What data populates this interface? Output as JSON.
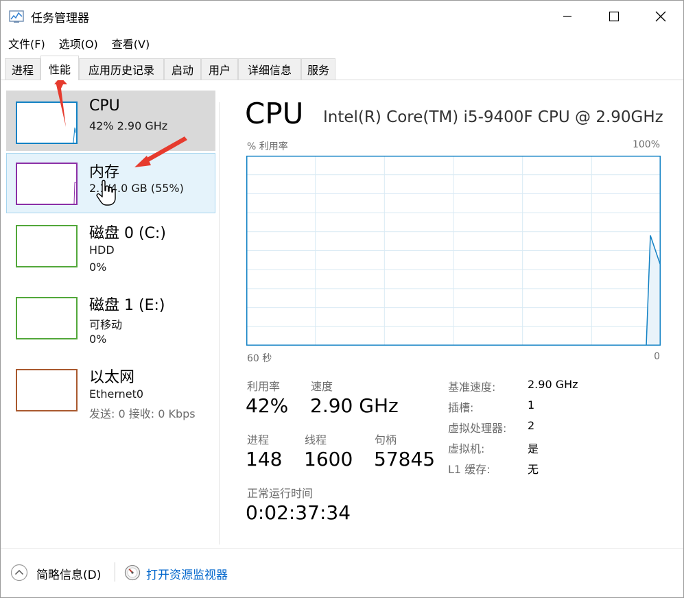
{
  "window": {
    "title": "任务管理器",
    "controls": [
      "minimize",
      "maximize",
      "close"
    ]
  },
  "menu": [
    "文件(F)",
    "选项(O)",
    "查看(V)"
  ],
  "tabs": [
    {
      "label": "进程"
    },
    {
      "label": "性能"
    },
    {
      "label": "应用历史记录"
    },
    {
      "label": "启动"
    },
    {
      "label": "用户"
    },
    {
      "label": "详细信息"
    },
    {
      "label": "服务"
    }
  ],
  "active_tab": "性能",
  "sidebar": [
    {
      "title": "CPU",
      "line1": "42% 2.90 GHz",
      "line2": "",
      "color": "#1181c4",
      "state": "selected"
    },
    {
      "title": "内存",
      "line1": "2.1/4.0 GB (55%)",
      "line2": "",
      "color": "#8b2fa6",
      "state": "hover"
    },
    {
      "title": "磁盘 0 (C:)",
      "line1": "HDD",
      "line2": "0%",
      "color": "#52a73a",
      "state": ""
    },
    {
      "title": "磁盘 1 (E:)",
      "line1": "可移动",
      "line2": "0%",
      "color": "#52a73a",
      "state": ""
    },
    {
      "title": "以太网",
      "line1": "Ethernet0",
      "line2": "发送: 0 接收: 0 Kbps",
      "color": "#a9592e",
      "state": ""
    }
  ],
  "main": {
    "heading": "CPU",
    "model": "Intel(R) Core(TM) i5-9400F CPU @ 2.90GHz",
    "graph_label": "% 利用率",
    "graph_max": "100%",
    "time_left": "60 秒",
    "time_right": "0",
    "stats": {
      "utilization_label": "利用率",
      "utilization": "42%",
      "speed_label": "速度",
      "speed": "2.90 GHz",
      "processes_label": "进程",
      "processes": "148",
      "threads_label": "线程",
      "threads": "1600",
      "handles_label": "句柄",
      "handles": "57845",
      "uptime_label": "正常运行时间",
      "uptime": "0:02:37:34"
    },
    "details": [
      {
        "label": "基准速度:",
        "value": "2.90 GHz"
      },
      {
        "label": "插槽:",
        "value": "1"
      },
      {
        "label": "虚拟处理器:",
        "value": "2"
      },
      {
        "label": "虚拟机:",
        "value": "是"
      },
      {
        "label": "L1 缓存:",
        "value": "无"
      }
    ]
  },
  "cpu_usage_history": [
    0,
    0,
    0,
    0,
    0,
    0,
    0,
    0,
    0,
    0,
    0,
    0,
    0,
    0,
    0,
    0,
    0,
    0,
    0,
    0,
    0,
    0,
    0,
    0,
    0,
    0,
    0,
    0,
    0,
    0,
    0,
    0,
    0,
    0,
    0,
    0,
    0,
    0,
    0,
    0,
    0,
    0,
    0,
    0,
    0,
    0,
    0,
    0,
    0,
    0,
    0,
    0,
    0,
    0,
    0,
    0,
    0,
    0,
    58,
    42
  ],
  "footer": {
    "fewer_details": "简略信息(D)",
    "open_monitor": "打开资源监视器"
  },
  "colors": {
    "cpu_line": "#1181c4",
    "grid": "#d9eaf4",
    "arrow": "#e63b2e",
    "link": "#0066cc"
  }
}
